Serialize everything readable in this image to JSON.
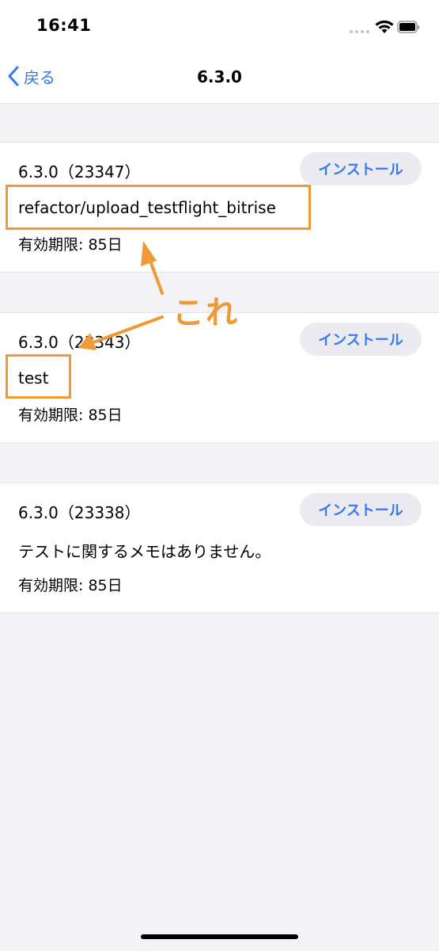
{
  "status_bar": {
    "time": "16:41"
  },
  "nav": {
    "back_label": "戻る",
    "title": "6.3.0"
  },
  "builds": [
    {
      "version": "6.3.0（23347）",
      "note": "refactor/upload_testflight_bitrise",
      "expiry": "有効期限: 85日",
      "install_label": "インストール"
    },
    {
      "version": "6.3.0（23343）",
      "note": "test",
      "expiry": "有効期限: 85日",
      "install_label": "インストール"
    },
    {
      "version": "6.3.0（23338）",
      "note": "テストに関するメモはありません。",
      "expiry": "有効期限: 85日",
      "install_label": "インストール"
    }
  ],
  "annotation": {
    "label": "これ",
    "color": "#ef9a35"
  },
  "colors": {
    "accent": "#3478f6",
    "background": "#f2f2f7",
    "annotation": "#ef9a35"
  },
  "icons": [
    "signal-icon",
    "wifi-icon",
    "battery-icon",
    "chevron-left-icon"
  ]
}
